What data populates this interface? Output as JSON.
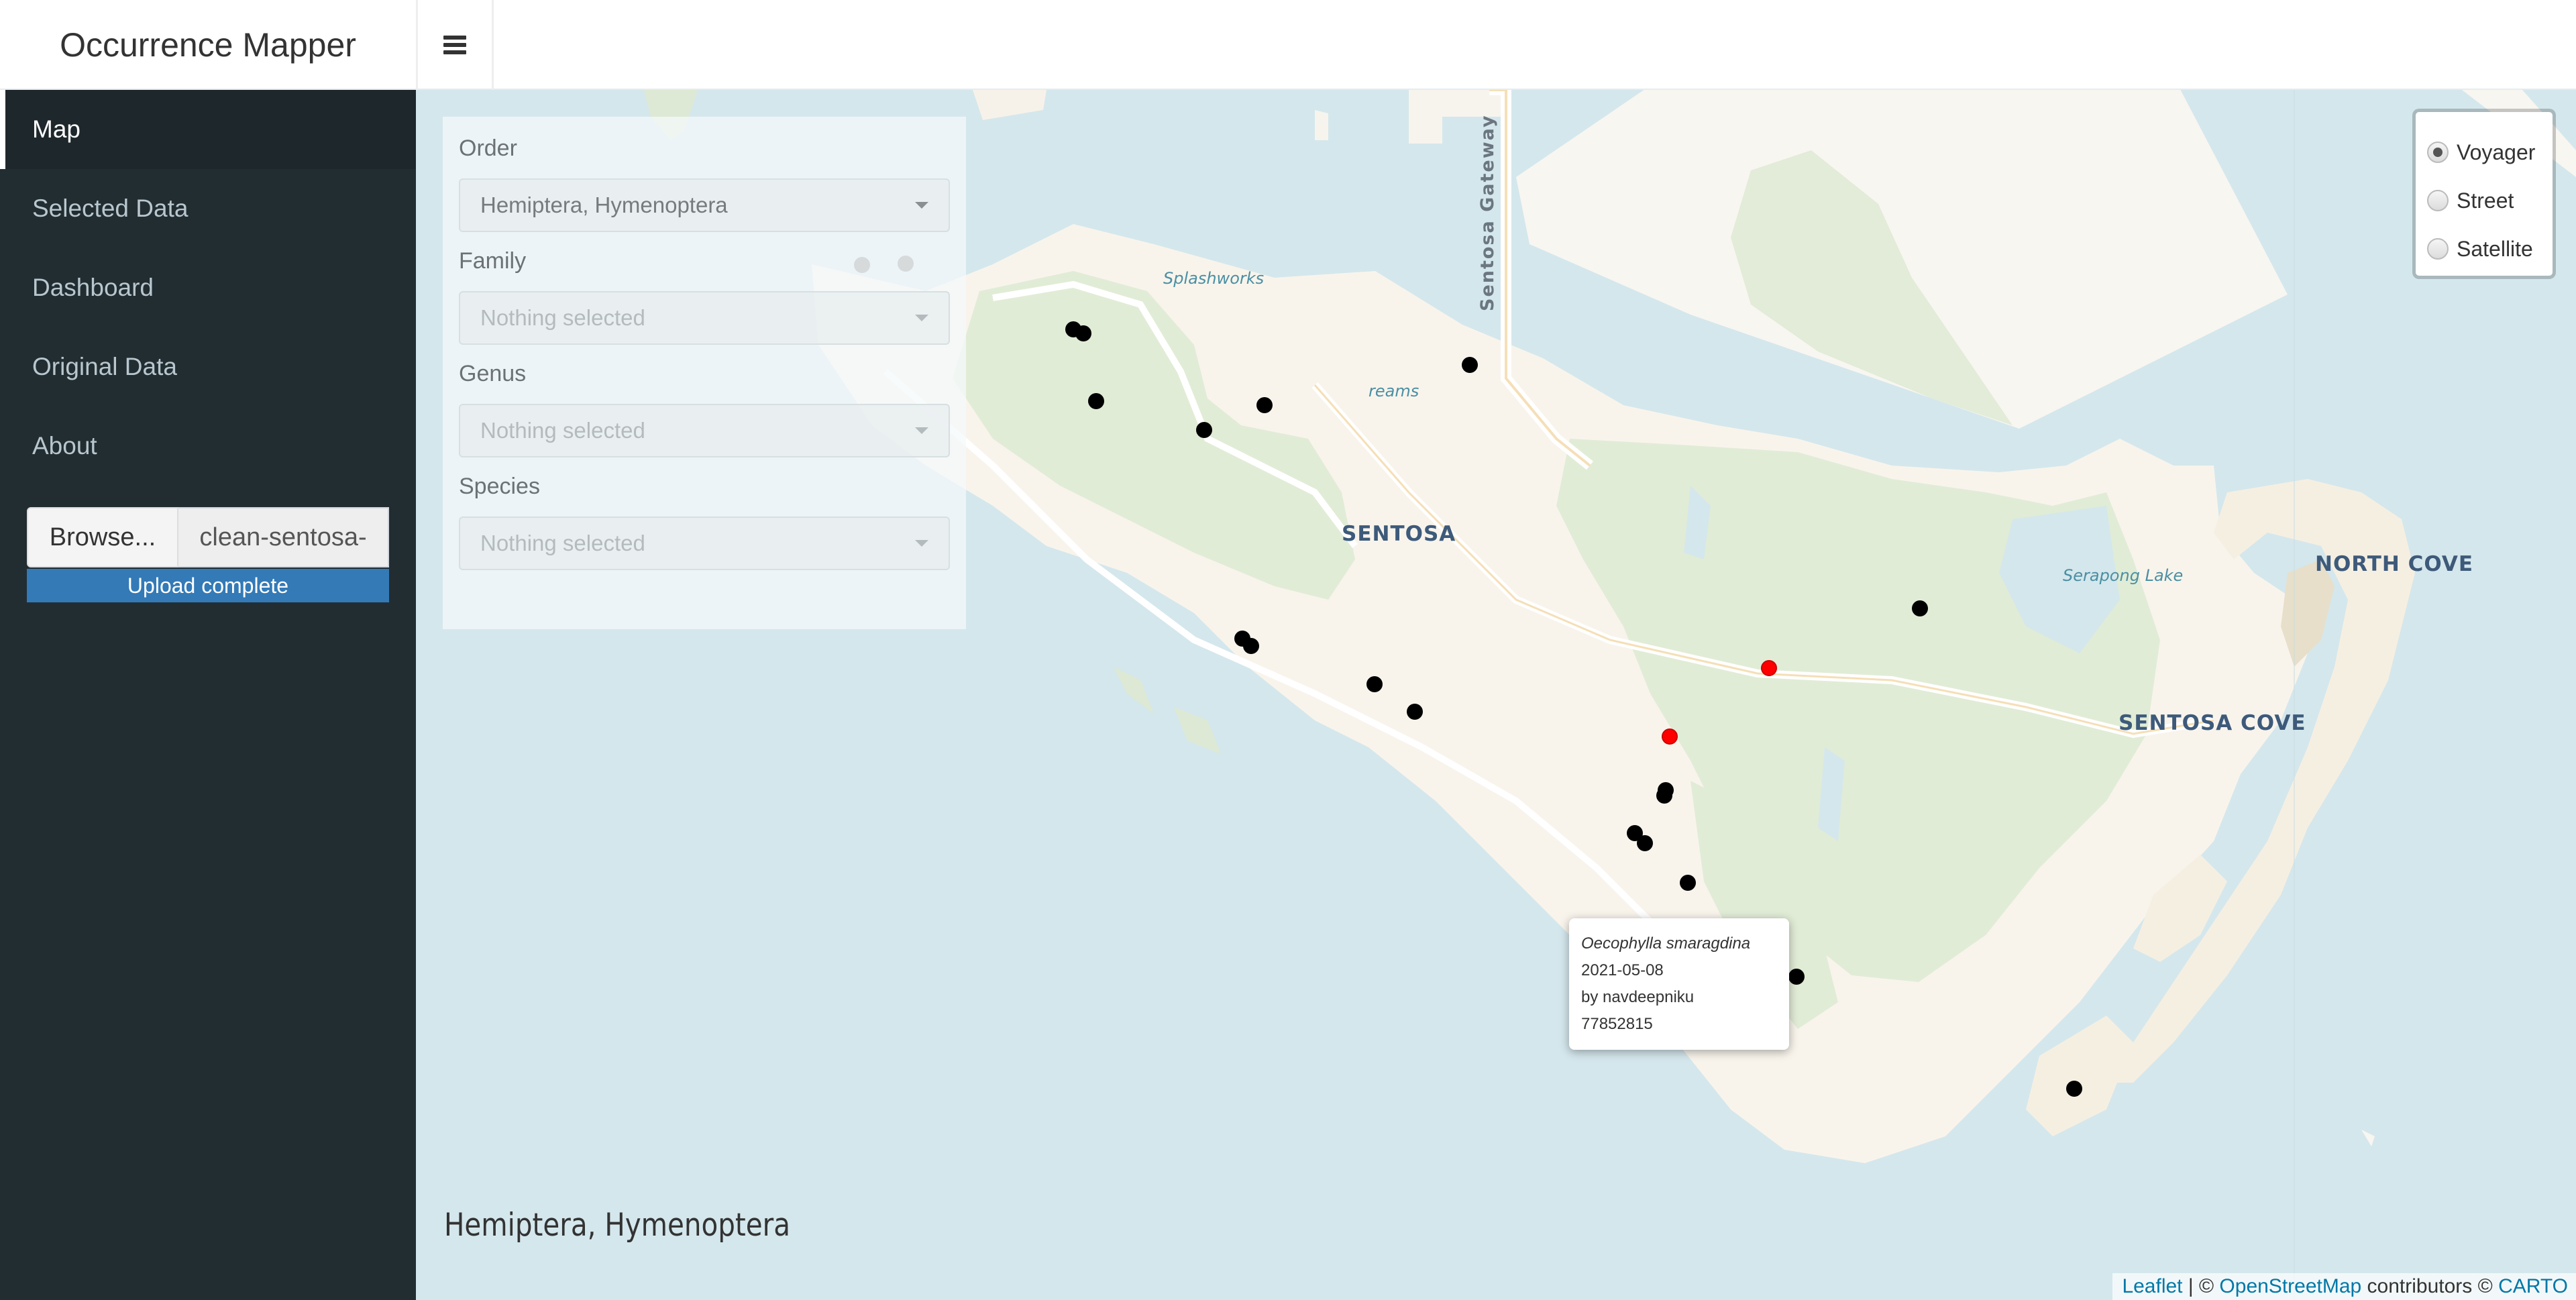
{
  "app": {
    "title": "Occurrence Mapper",
    "menu_icon": "hamburger-icon"
  },
  "sidebar": {
    "items": [
      {
        "label": "Map",
        "active": true
      },
      {
        "label": "Selected Data",
        "active": false
      },
      {
        "label": "Dashboard",
        "active": false
      },
      {
        "label": "Original Data",
        "active": false
      },
      {
        "label": "About",
        "active": false
      }
    ],
    "file_upload": {
      "browse_label": "Browse...",
      "file_name": "clean-sentosa-",
      "status": "Upload complete",
      "progress_percent": 100,
      "status_color": "#337ab7"
    }
  },
  "filters": [
    {
      "label": "Order",
      "value": "Hemiptera, Hymenoptera",
      "is_placeholder": false
    },
    {
      "label": "Family",
      "value": "Nothing selected",
      "is_placeholder": true
    },
    {
      "label": "Genus",
      "value": "Nothing selected",
      "is_placeholder": true
    },
    {
      "label": "Species",
      "value": "Nothing selected",
      "is_placeholder": true
    }
  ],
  "layer_control": {
    "options": [
      {
        "label": "Voyager",
        "checked": true
      },
      {
        "label": "Street",
        "checked": false
      },
      {
        "label": "Satellite",
        "checked": false
      }
    ]
  },
  "map": {
    "labels": {
      "sentosa": "SENTOSA",
      "sentosa_cove": "SENTOSA COVE",
      "north_cove": "NORTH COVE",
      "serapong_lake": "Serapong Lake",
      "splashworks": "Splashworks",
      "dreams": "reams",
      "sentosa_gateway": "Sentosa Gateway"
    },
    "marker_colors": {
      "default": "#000000",
      "highlight": "#ff0000",
      "faded": "#888888"
    },
    "markers": [
      {
        "color": "faded"
      },
      {
        "color": "faded"
      },
      {
        "color": "default"
      },
      {
        "color": "default"
      },
      {
        "color": "default"
      },
      {
        "color": "default"
      },
      {
        "color": "default"
      },
      {
        "color": "default"
      },
      {
        "color": "default"
      },
      {
        "color": "default"
      },
      {
        "color": "default"
      },
      {
        "color": "default"
      },
      {
        "color": "highlight"
      },
      {
        "color": "highlight"
      },
      {
        "color": "default"
      },
      {
        "color": "default"
      },
      {
        "color": "default"
      },
      {
        "color": "default"
      },
      {
        "color": "default"
      },
      {
        "color": "default"
      },
      {
        "color": "default"
      },
      {
        "color": "default"
      }
    ],
    "popup": {
      "species": "Oecophylla smaragdina",
      "date": "2021-05-08",
      "observer": "by navdeepniku",
      "id": "77852815"
    },
    "selection_title": "Hemiptera, Hymenoptera",
    "attribution": {
      "leaflet": "Leaflet",
      "sep": " | © ",
      "osm": "OpenStreetMap",
      "contributors": " contributors © ",
      "carto": "CARTO"
    }
  }
}
